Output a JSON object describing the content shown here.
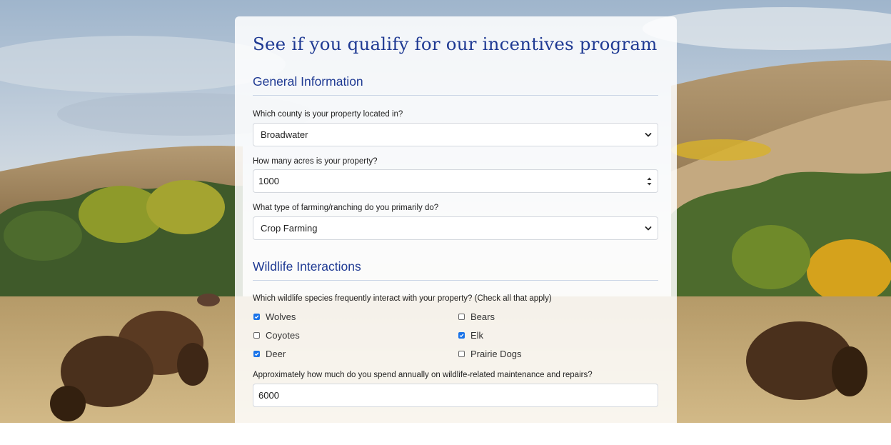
{
  "form": {
    "title": "See if you qualify for our incentives program",
    "general": {
      "heading": "General Information",
      "county_label": "Which county is your property located in?",
      "county_value": "Broadwater",
      "acres_label": "How many acres is your property?",
      "acres_value": "1000",
      "farming_label": "What type of farming/ranching do you primarily do?",
      "farming_value": "Crop Farming"
    },
    "wildlife": {
      "heading": "Wildlife Interactions",
      "species_label": "Which wildlife species frequently interact with your property? (Check all that apply)",
      "species": [
        {
          "label": "Wolves",
          "checked": true
        },
        {
          "label": "Bears",
          "checked": false
        },
        {
          "label": "Coyotes",
          "checked": false
        },
        {
          "label": "Elk",
          "checked": true
        },
        {
          "label": "Deer",
          "checked": true
        },
        {
          "label": "Prairie Dogs",
          "checked": false
        }
      ],
      "spend_label": "Approximately how much do you spend annually on wildlife-related maintenance and repairs?",
      "spend_value": "6000"
    }
  },
  "colors": {
    "heading": "#1f3a93",
    "checkbox_checked": "#1a73e8"
  }
}
